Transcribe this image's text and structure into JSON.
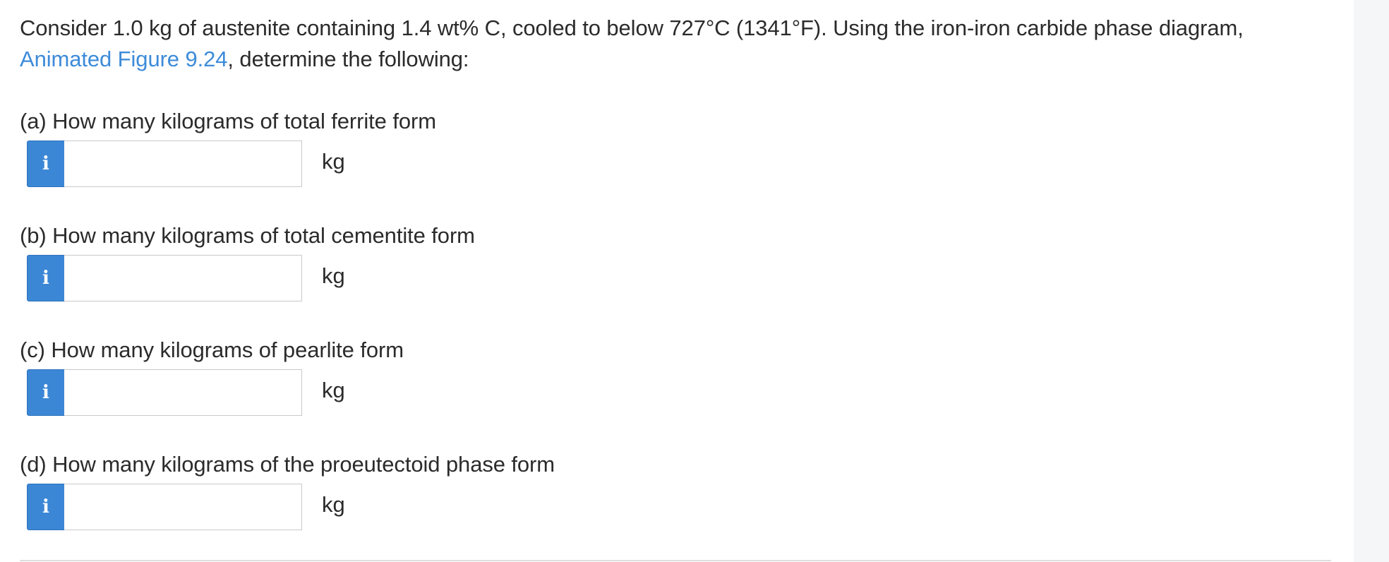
{
  "intro": {
    "text_before": "Consider 1.0 kg of austenite containing 1.4 wt% C, cooled to below 727°C (1341°F). Using the iron-iron carbide phase diagram,",
    "link_text": "Animated Figure 9.24",
    "text_after": ", determine the following:"
  },
  "questions": [
    {
      "label": "(a) How many kilograms of total ferrite form",
      "value": "",
      "unit": "kg",
      "info_icon": "i"
    },
    {
      "label": "(b) How many kilograms of total cementite form",
      "value": "",
      "unit": "kg",
      "info_icon": "i"
    },
    {
      "label": "(c) How many kilograms of pearlite form",
      "value": "",
      "unit": "kg",
      "info_icon": "i"
    },
    {
      "label": "(d) How many kilograms of the proeutectoid phase form",
      "value": "",
      "unit": "kg",
      "info_icon": "i"
    }
  ],
  "colors": {
    "link": "#3d8bd9",
    "info_button": "#3b87d6",
    "text": "#2b2b2b"
  }
}
